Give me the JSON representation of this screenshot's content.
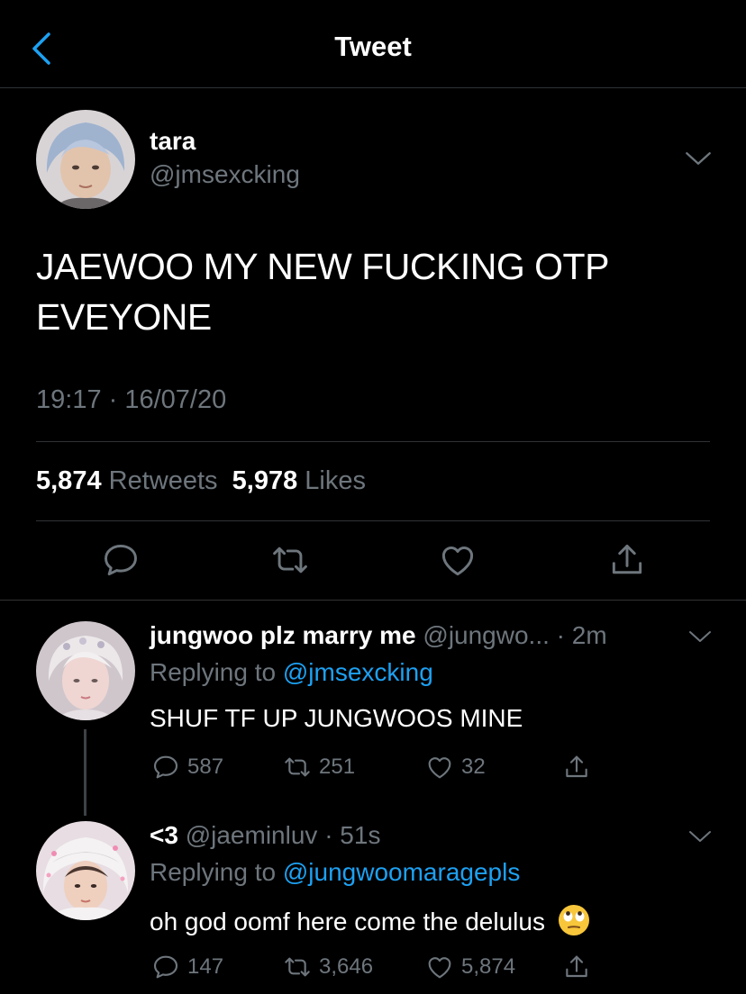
{
  "header": {
    "title": "Tweet"
  },
  "main_tweet": {
    "name": "tara",
    "handle": "@jmsexcking",
    "text": "JAEWOO MY NEW FUCKING OTP EVEYONE",
    "timestamp": "19:17 · 16/07/20",
    "retweet_count": "5,874",
    "retweets_label": "Retweets",
    "like_count": "5,978",
    "likes_label": "Likes"
  },
  "replies": [
    {
      "name": "jungwoo plz marry me",
      "handle": "@jungwo...",
      "time": "· 2m",
      "replying_prefix": "Replying to",
      "replying_to": "@jmsexcking",
      "text": "SHUF TF UP JUNGWOOS MINE",
      "replies": "587",
      "retweets": "251",
      "likes": "32"
    },
    {
      "name": "<3",
      "handle": "@jaeminluv",
      "time": "· 51s",
      "replying_prefix": "Replying to",
      "replying_to": "@jungwoomaragepls",
      "text": "oh god oomf here come the delulus",
      "emoji": "🙄",
      "replies": "147",
      "retweets": "3,646",
      "likes": "5,874"
    }
  ],
  "icons": {
    "back": "chevron-left-icon",
    "caret": "chevron-down-icon",
    "reply": "comment-icon",
    "retweet": "retweet-icon",
    "like": "heart-icon",
    "share": "share-icon"
  },
  "colors": {
    "background": "#000000",
    "accent": "#1da1f2",
    "muted": "#6e767d",
    "divider": "#2f3336"
  }
}
